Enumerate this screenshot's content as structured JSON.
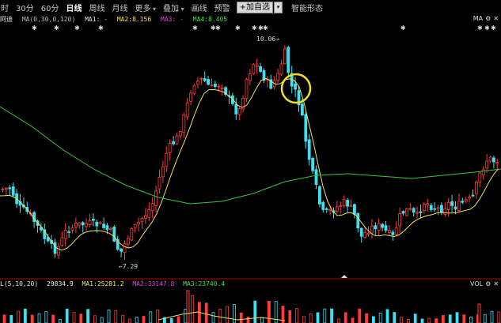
{
  "toolbar": {
    "timeframes": [
      {
        "label": "时",
        "active": false,
        "dropdown": false
      },
      {
        "label": "30分",
        "active": false,
        "dropdown": false
      },
      {
        "label": "60分",
        "active": false,
        "dropdown": false
      },
      {
        "label": "日线",
        "active": true,
        "dropdown": false
      },
      {
        "label": "周线",
        "active": false,
        "dropdown": false
      },
      {
        "label": "月线",
        "active": false,
        "dropdown": false
      },
      {
        "label": "更多",
        "active": false,
        "dropdown": true
      },
      {
        "label": "叠加",
        "active": false,
        "dropdown": true
      },
      {
        "label": "画线",
        "active": false,
        "dropdown": false
      },
      {
        "label": "预警",
        "active": false,
        "dropdown": false
      }
    ],
    "add_watchlist": "+加自选",
    "add_dropdown": "▾",
    "pattern": "智能形态"
  },
  "legend": {
    "name": "阿迪",
    "params": "MA(0,30,0,120)",
    "ma1": "MA1: -",
    "ma2": "MA2:8.156",
    "ma3": "MA3: -",
    "ma4": "MA4:8.405",
    "right_label": "MA",
    "gear": "⚙",
    "close": "✕"
  },
  "price_labels": {
    "high": "10.06",
    "low": "7.29"
  },
  "volume_legend": {
    "params": "L(5,10,20)",
    "value": "29834.9",
    "ma1": "MA1:25281.2",
    "ma2": "MA2:33147.8",
    "ma3": "MA3:23740.4",
    "right_label": "VOL",
    "gear": "⚙",
    "close": "✕"
  },
  "colors": {
    "up": "#ff3b3b",
    "down": "#3fe0f0",
    "ma_short": "#f0e060",
    "ma_long": "#38c838",
    "highlight": "#f0e020",
    "divider": "#b00000"
  }
}
